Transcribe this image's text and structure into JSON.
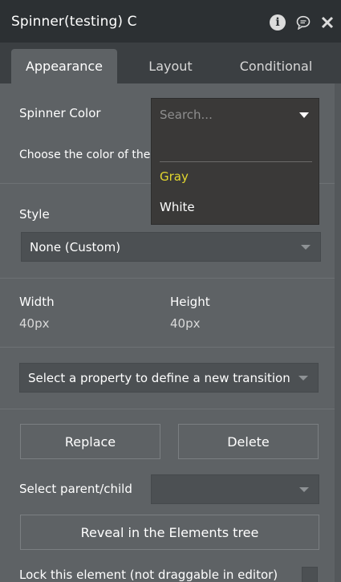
{
  "window": {
    "title": "Spinner(testing) C"
  },
  "icons": {
    "info": "info-icon",
    "comment": "chat-bubble-icon",
    "close": "close-icon"
  },
  "tabs": [
    "Appearance",
    "Layout",
    "Conditional"
  ],
  "spinner_color": {
    "label": "Spinner Color",
    "hint": "Choose the color of the Sp",
    "search_placeholder": "Search...",
    "options": [
      "Gray",
      "White"
    ]
  },
  "style": {
    "label": "Style",
    "value": "None (Custom)"
  },
  "size": {
    "width_label": "Width",
    "width_value": "40px",
    "height_label": "Height",
    "height_value": "40px"
  },
  "transition": {
    "placeholder": "Select a property to define a new transition"
  },
  "actions": {
    "replace": "Replace",
    "delete": "Delete"
  },
  "parent_child": {
    "label": "Select parent/child",
    "value": ""
  },
  "reveal": {
    "label": "Reveal in the Elements tree"
  },
  "lock": {
    "label": "Lock this element (not draggable in editor)",
    "checked": false
  },
  "colors": {
    "panel": "#5e6265",
    "titlebar": "#2c3033",
    "highlight": "#e2d62e"
  }
}
